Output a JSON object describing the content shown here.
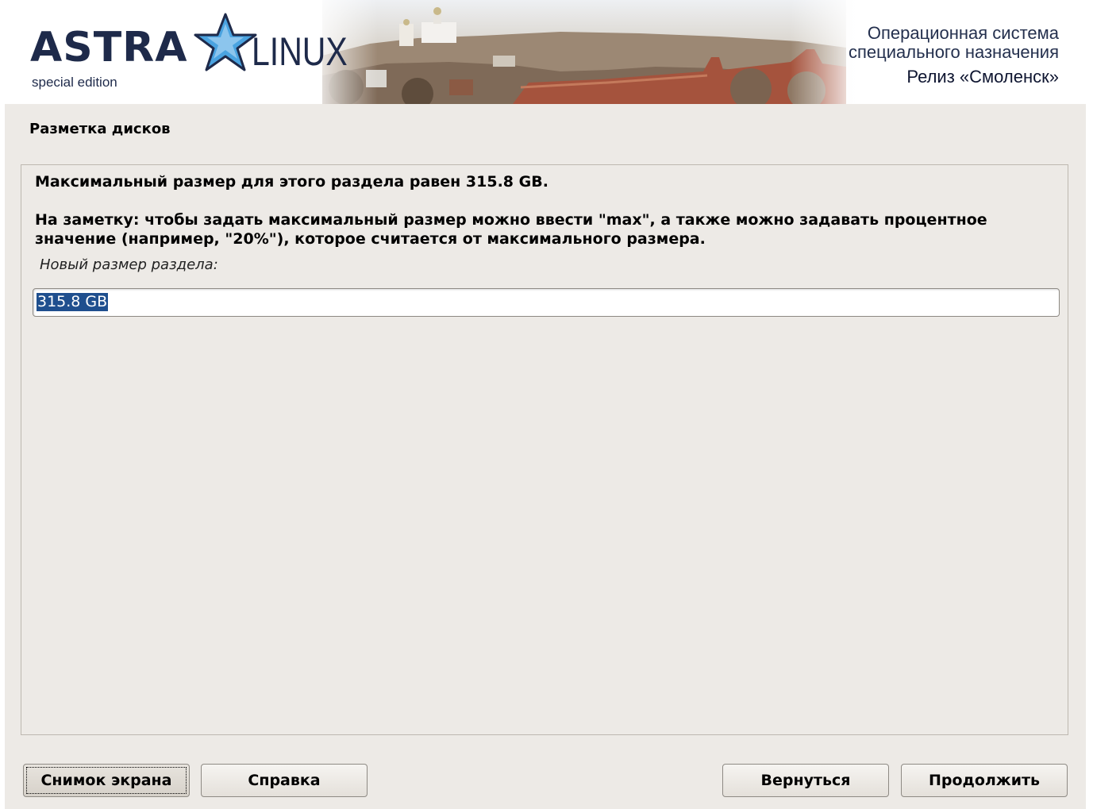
{
  "banner": {
    "logo_name": "ASTRA",
    "logo_suffix": "LINUX",
    "logo_edition": "special edition",
    "os_line1": "Операционная система",
    "os_line2": "специального назначения",
    "os_release": "Релиз «Смоленск»",
    "brand_color": "#1e2a4a",
    "star_color": "#2f7fc4"
  },
  "page": {
    "title": "Разметка дисков"
  },
  "panel": {
    "max_size_message": "Максимальный размер для этого раздела равен 315.8 GB.",
    "note_message": "На заметку: чтобы задать максимальный размер можно ввести \"max\", а также можно задавать процентное значение (например, \"20%\"), которое считается от максимального размера.",
    "field_label": "Новый размер раздела:",
    "size_value": "315.8 GB",
    "selection_color": "#1f4f8e"
  },
  "buttons": {
    "screenshot": "Снимок экрана",
    "help": "Справка",
    "back": "Вернуться",
    "continue": "Продолжить"
  }
}
